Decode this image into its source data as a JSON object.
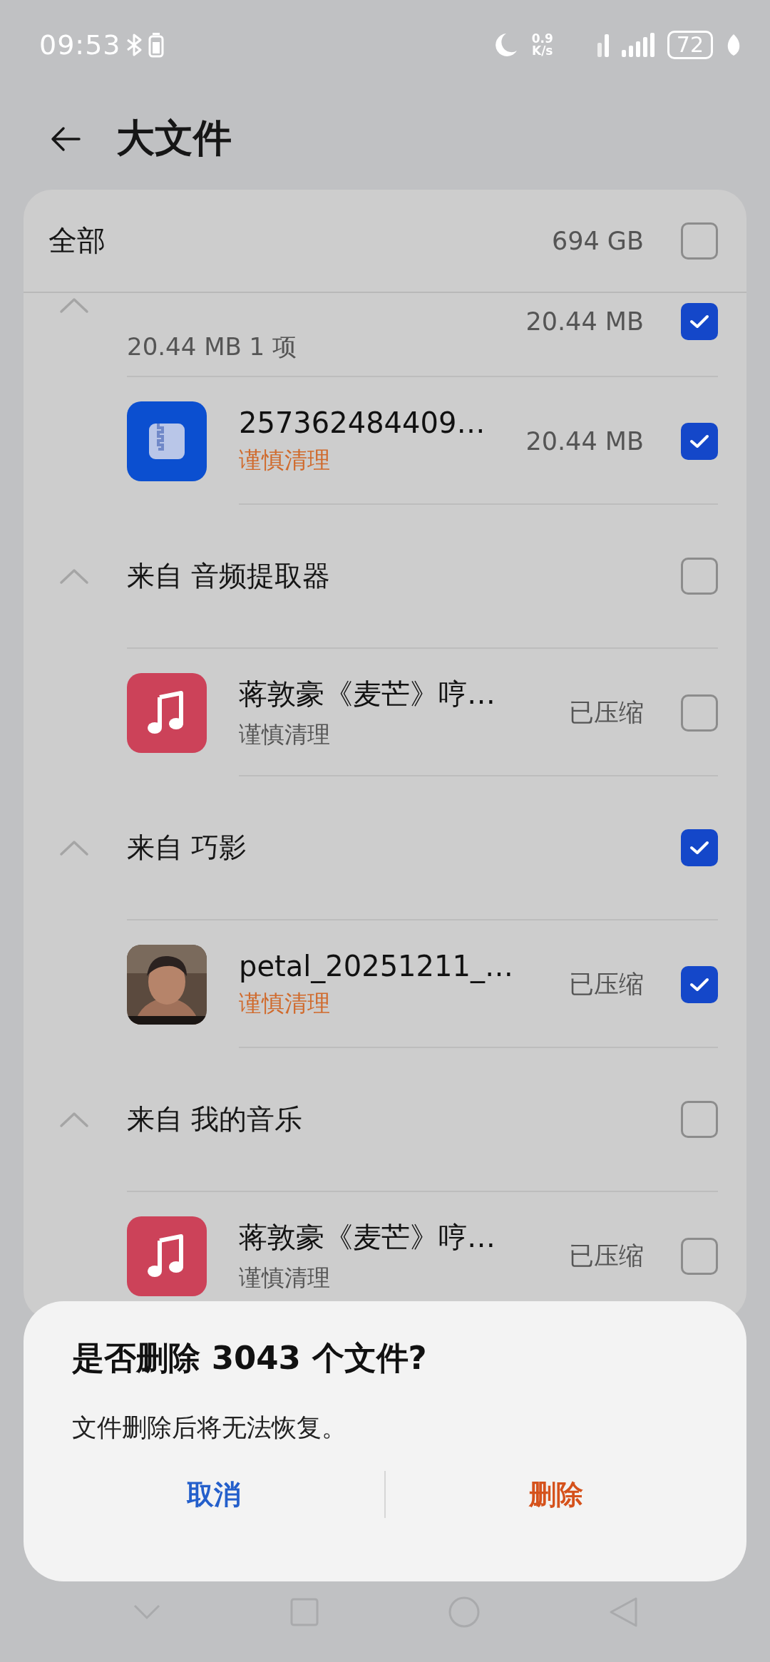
{
  "status_bar": {
    "time": "09:53",
    "speed_value": "0.9",
    "speed_unit": "K/s",
    "battery": "72"
  },
  "header": {
    "title": "大文件"
  },
  "all_row": {
    "label": "全部",
    "size": "694 GB",
    "checked": false
  },
  "groups": [
    {
      "summary": "20.44 MB 1 项",
      "size": "20.44 MB",
      "checked": true,
      "expanded": true,
      "files": [
        {
          "name": "257362484409…",
          "tag": "谨慎清理",
          "caution": true,
          "info": "20.44 MB",
          "checked": true,
          "kind": "zip"
        }
      ]
    },
    {
      "title": "来自 音频提取器",
      "checked": false,
      "expanded": true,
      "files": [
        {
          "name": "蒋敦豪《麦芒》哼…",
          "tag": "谨慎清理",
          "caution": false,
          "info": "已压缩",
          "checked": false,
          "kind": "music"
        }
      ]
    },
    {
      "title": "来自 巧影",
      "checked": true,
      "expanded": true,
      "files": [
        {
          "name": "petal_20251211_…",
          "tag": "谨慎清理",
          "caution": true,
          "info": "已压缩",
          "checked": true,
          "kind": "picture"
        }
      ]
    },
    {
      "title": "来自 我的音乐",
      "checked": false,
      "expanded": true,
      "files": [
        {
          "name": "蒋敦豪《麦芒》哼…",
          "tag": "谨慎清理",
          "caution": false,
          "info": "已压缩",
          "checked": false,
          "kind": "music"
        }
      ]
    }
  ],
  "dialog": {
    "title": "是否删除 3043 个文件?",
    "message": "文件删除后将无法恢复。",
    "buttons": [
      {
        "label": "取消",
        "kind": "cancel"
      },
      {
        "label": "删除",
        "kind": "delete"
      }
    ]
  }
}
